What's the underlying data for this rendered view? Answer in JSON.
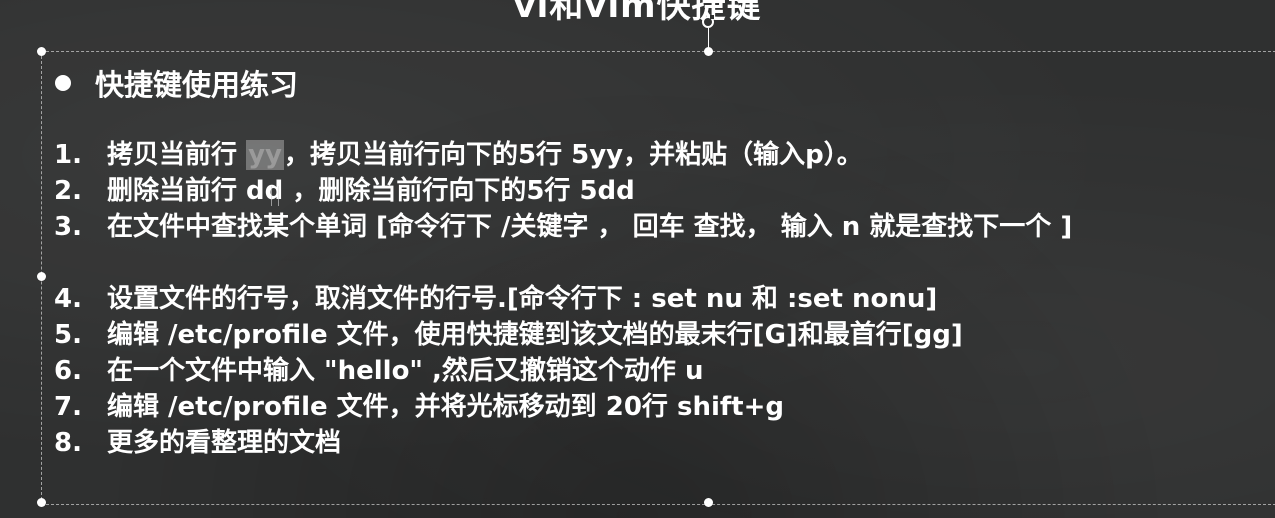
{
  "slide": {
    "title": "vi和vim快捷键",
    "heading": "快捷键使用练习",
    "items": [
      {
        "num": "1.",
        "pre": "拷贝当前行  ",
        "highlight": "yy",
        "post": "，拷贝当前行向下的5行  5yy，并粘贴（输入p）。"
      },
      {
        "num": "2.",
        "text": "删除当前行  dd ，删除当前行向下的5行 5dd"
      },
      {
        "num": "3.",
        "text": "在文件中查找某个单词 [命令行下 /关键字  ， 回车 查找， 输入 n 就是查找下一个 ]"
      },
      {
        "num": "4.",
        "text": "设置文件的行号，取消文件的行号.[命令行下  : set nu 和  :set nonu]"
      },
      {
        "num": "5.",
        "text": "编辑 /etc/profile 文件，使用快捷键到该文档的最末行[G]和最首行[gg]"
      },
      {
        "num": "6.",
        "text": "在一个文件中输入 \"hello\" ,然后又撤销这个动作  u"
      },
      {
        "num": "7.",
        "text": "编辑  /etc/profile 文件，并将光标移动到  20行 shift+g"
      },
      {
        "num": "8.",
        "text": "更多的看整理的文档"
      }
    ]
  }
}
